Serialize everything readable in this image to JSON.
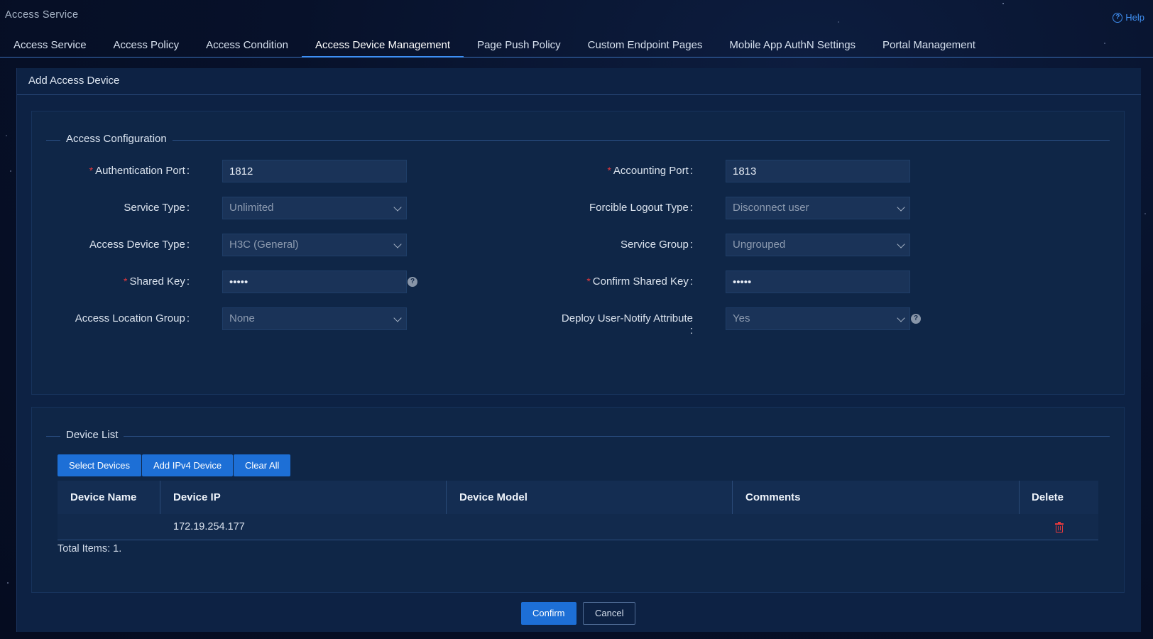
{
  "app": {
    "title": "Access Service",
    "help_label": "Help"
  },
  "tabs": [
    {
      "label": "Access Service",
      "active": false
    },
    {
      "label": "Access Policy",
      "active": false
    },
    {
      "label": "Access Condition",
      "active": false
    },
    {
      "label": "Access Device Management",
      "active": true
    },
    {
      "label": "Page Push Policy",
      "active": false
    },
    {
      "label": "Custom Endpoint Pages",
      "active": false
    },
    {
      "label": "Mobile App AuthN Settings",
      "active": false
    },
    {
      "label": "Portal Management",
      "active": false
    }
  ],
  "page": {
    "title": "Add Access Device"
  },
  "config": {
    "legend": "Access Configuration",
    "auth_port": {
      "label": "Authentication Port",
      "value": "1812",
      "required": true
    },
    "acct_port": {
      "label": "Accounting Port",
      "value": "1813",
      "required": true
    },
    "service_type": {
      "label": "Service Type",
      "value": "Unlimited"
    },
    "logout_type": {
      "label": "Forcible Logout Type",
      "value": "Disconnect user"
    },
    "device_type": {
      "label": "Access Device Type",
      "value": "H3C (General)"
    },
    "service_group": {
      "label": "Service Group",
      "value": "Ungrouped"
    },
    "shared_key": {
      "label": "Shared Key",
      "value": "•••••",
      "required": true
    },
    "confirm_key": {
      "label": "Confirm Shared Key",
      "value": "•••••",
      "required": true
    },
    "location_group": {
      "label": "Access Location Group",
      "value": "None"
    },
    "notify_attr": {
      "label": "Deploy User-Notify Attribute",
      "value": "Yes"
    },
    "colon": ":",
    "required_mark": "*",
    "info_glyph": "?"
  },
  "device_list": {
    "legend": "Device List",
    "buttons": {
      "select": "Select Devices",
      "add_ipv4": "Add IPv4 Device",
      "clear": "Clear All"
    },
    "columns": [
      "Device Name",
      "Device IP",
      "Device Model",
      "Comments",
      "Delete"
    ],
    "rows": [
      {
        "name": "",
        "ip": "172.19.254.177",
        "model": "",
        "comments": ""
      }
    ],
    "total": "Total Items: 1."
  },
  "footer": {
    "confirm": "Confirm",
    "cancel": "Cancel"
  },
  "colors": {
    "accent": "#1d6fd6",
    "required": "#e5393d",
    "panel": "#0f2647"
  }
}
